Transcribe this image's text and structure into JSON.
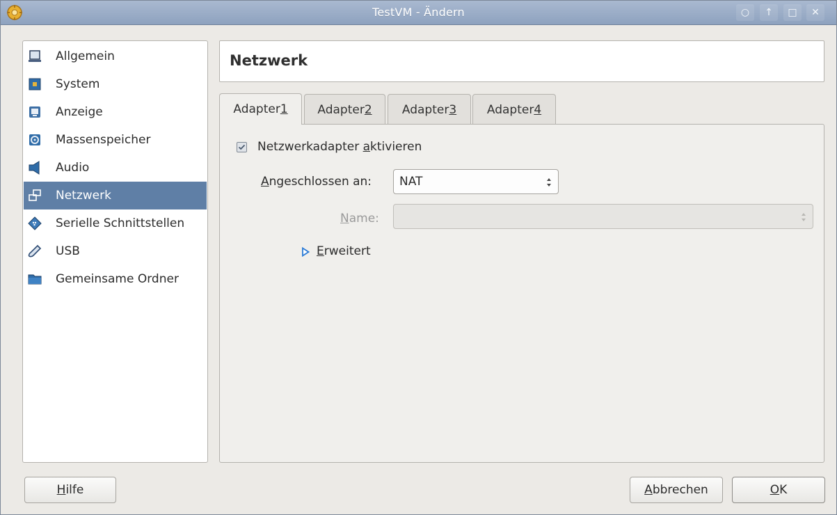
{
  "window": {
    "title": "TestVM - Ändern",
    "controls": [
      "context-help",
      "keep-above",
      "maximize",
      "close"
    ]
  },
  "sidebar": {
    "items": [
      {
        "label": "Allgemein",
        "icon": "general-icon",
        "selected": false
      },
      {
        "label": "System",
        "icon": "system-icon",
        "selected": false
      },
      {
        "label": "Anzeige",
        "icon": "display-icon",
        "selected": false
      },
      {
        "label": "Massenspeicher",
        "icon": "storage-icon",
        "selected": false
      },
      {
        "label": "Audio",
        "icon": "audio-icon",
        "selected": false
      },
      {
        "label": "Netzwerk",
        "icon": "network-icon",
        "selected": true
      },
      {
        "label": "Serielle Schnittstellen",
        "icon": "serial-ports-icon",
        "selected": false
      },
      {
        "label": "USB",
        "icon": "usb-icon",
        "selected": false
      },
      {
        "label": "Gemeinsame Ordner",
        "icon": "shared-folders-icon",
        "selected": false
      }
    ]
  },
  "page": {
    "title": "Netzwerk"
  },
  "tabs": [
    {
      "label_prefix": "Adapter ",
      "label_mnemonic": "1",
      "active": true
    },
    {
      "label_prefix": "Adapter ",
      "label_mnemonic": "2",
      "active": false
    },
    {
      "label_prefix": "Adapter ",
      "label_mnemonic": "3",
      "active": false
    },
    {
      "label_prefix": "Adapter ",
      "label_mnemonic": "4",
      "active": false
    }
  ],
  "adapter": {
    "enable_label_prefix": "Netzwerkadapter ",
    "enable_label_mnemonic": "a",
    "enable_label_rest": "ktivieren",
    "enabled": true,
    "attached_label_mnemonic": "A",
    "attached_label_rest": "ngeschlossen an:",
    "attached_value": "NAT",
    "name_label_mnemonic": "N",
    "name_label_rest": "ame:",
    "name_value": "",
    "advanced_label_mnemonic": "E",
    "advanced_label_rest": "rweitert",
    "advanced_expanded": false
  },
  "buttons": {
    "help_mnemonic": "H",
    "help_rest": "ilfe",
    "cancel_mnemonic": "A",
    "cancel_rest": "bbrechen",
    "ok_mnemonic": "O",
    "ok_rest": "K"
  },
  "colors": {
    "titlebar": "#8ea2bf",
    "selection": "#5f7fa6",
    "expander": "#2a7ad6"
  }
}
